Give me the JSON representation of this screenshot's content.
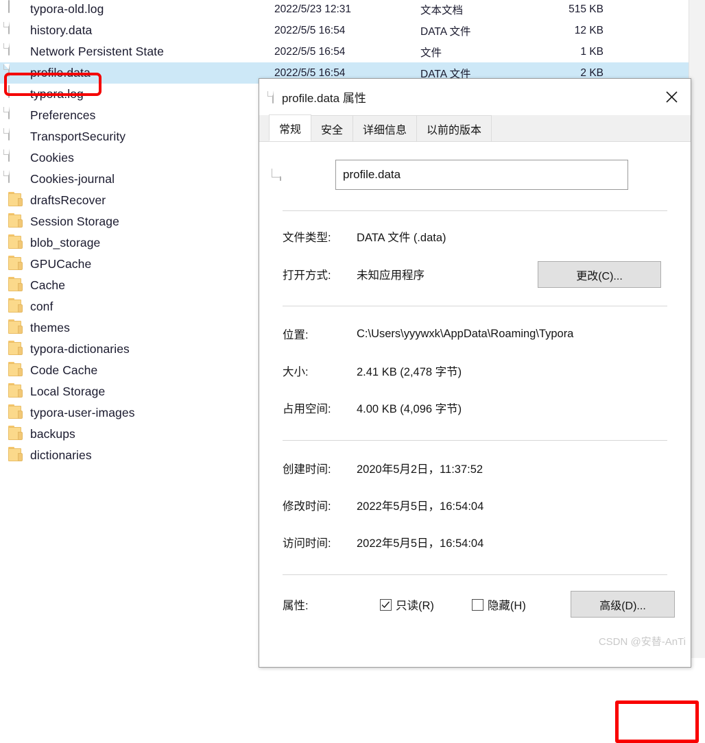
{
  "explorer": {
    "rows": [
      {
        "icon": "text-file-icon",
        "name": "typora-old.log",
        "date": "2022/5/23 12:31",
        "type": "文本文档",
        "size": "515 KB",
        "selected": false
      },
      {
        "icon": "file-icon",
        "name": "history.data",
        "date": "2022/5/5 16:54",
        "type": "DATA 文件",
        "size": "12 KB",
        "selected": false
      },
      {
        "icon": "file-icon",
        "name": "Network Persistent State",
        "date": "2022/5/5 16:54",
        "type": "文件",
        "size": "1 KB",
        "selected": false
      },
      {
        "icon": "file-icon",
        "name": "profile.data",
        "date": "2022/5/5 16:54",
        "type": "DATA 文件",
        "size": "2 KB",
        "selected": true
      },
      {
        "icon": "text-file-icon",
        "name": "typora.log",
        "date": "",
        "type": "",
        "size": "",
        "selected": false
      },
      {
        "icon": "file-icon",
        "name": "Preferences",
        "date": "",
        "type": "",
        "size": "",
        "selected": false
      },
      {
        "icon": "file-icon",
        "name": "TransportSecurity",
        "date": "",
        "type": "",
        "size": "",
        "selected": false
      },
      {
        "icon": "file-icon",
        "name": "Cookies",
        "date": "",
        "type": "",
        "size": "",
        "selected": false
      },
      {
        "icon": "file-icon",
        "name": "Cookies-journal",
        "date": "",
        "type": "",
        "size": "",
        "selected": false
      },
      {
        "icon": "folder-icon",
        "name": "draftsRecover",
        "date": "",
        "type": "",
        "size": "",
        "selected": false
      },
      {
        "icon": "folder-icon",
        "name": "Session Storage",
        "date": "",
        "type": "",
        "size": "",
        "selected": false
      },
      {
        "icon": "folder-icon",
        "name": "blob_storage",
        "date": "",
        "type": "",
        "size": "",
        "selected": false
      },
      {
        "icon": "folder-icon",
        "name": "GPUCache",
        "date": "",
        "type": "",
        "size": "",
        "selected": false
      },
      {
        "icon": "folder-icon",
        "name": "Cache",
        "date": "",
        "type": "",
        "size": "",
        "selected": false
      },
      {
        "icon": "folder-icon",
        "name": "conf",
        "date": "",
        "type": "",
        "size": "",
        "selected": false
      },
      {
        "icon": "folder-icon",
        "name": "themes",
        "date": "",
        "type": "",
        "size": "",
        "selected": false
      },
      {
        "icon": "folder-icon",
        "name": "typora-dictionaries",
        "date": "",
        "type": "",
        "size": "",
        "selected": false
      },
      {
        "icon": "folder-icon",
        "name": "Code Cache",
        "date": "",
        "type": "",
        "size": "",
        "selected": false
      },
      {
        "icon": "folder-icon",
        "name": "Local Storage",
        "date": "",
        "type": "",
        "size": "",
        "selected": false
      },
      {
        "icon": "folder-icon",
        "name": "typora-user-images",
        "date": "",
        "type": "",
        "size": "",
        "selected": false
      },
      {
        "icon": "folder-icon",
        "name": "backups",
        "date": "",
        "type": "",
        "size": "",
        "selected": false
      },
      {
        "icon": "folder-icon",
        "name": "dictionaries",
        "date": "",
        "type": "",
        "size": "",
        "selected": false
      }
    ]
  },
  "dialog": {
    "title": "profile.data 属性",
    "title_icon": "file-icon",
    "close_label": "✕",
    "tabs": [
      {
        "label": "常规",
        "active": true
      },
      {
        "label": "安全",
        "active": false
      },
      {
        "label": "详细信息",
        "active": false
      },
      {
        "label": "以前的版本",
        "active": false
      }
    ],
    "file_name": "profile.data",
    "fields": {
      "file_type_label": "文件类型:",
      "file_type_value": "DATA 文件 (.data)",
      "open_with_label": "打开方式:",
      "open_with_value": "未知应用程序",
      "change_button": "更改(C)...",
      "location_label": "位置:",
      "location_value": "C:\\Users\\yyywxk\\AppData\\Roaming\\Typora",
      "size_label": "大小:",
      "size_value": "2.41 KB (2,478 字节)",
      "disk_size_label": "占用空间:",
      "disk_size_value": "4.00 KB (4,096 字节)",
      "created_label": "创建时间:",
      "created_value": "2020年5月2日，11:37:52",
      "modified_label": "修改时间:",
      "modified_value": "2022年5月5日，16:54:04",
      "accessed_label": "访问时间:",
      "accessed_value": "2022年5月5日，16:54:04",
      "attributes_label": "属性:",
      "readonly_label": "只读(R)",
      "readonly_checked": true,
      "hidden_label": "隐藏(H)",
      "hidden_checked": false,
      "advanced_button": "高级(D)..."
    }
  },
  "watermark": "CSDN @安替-AnTi",
  "colors": {
    "selection": "#cde8f7",
    "annotation_red": "#f40000",
    "folder": "#fbd98b",
    "button_face": "#e1e1e1"
  }
}
